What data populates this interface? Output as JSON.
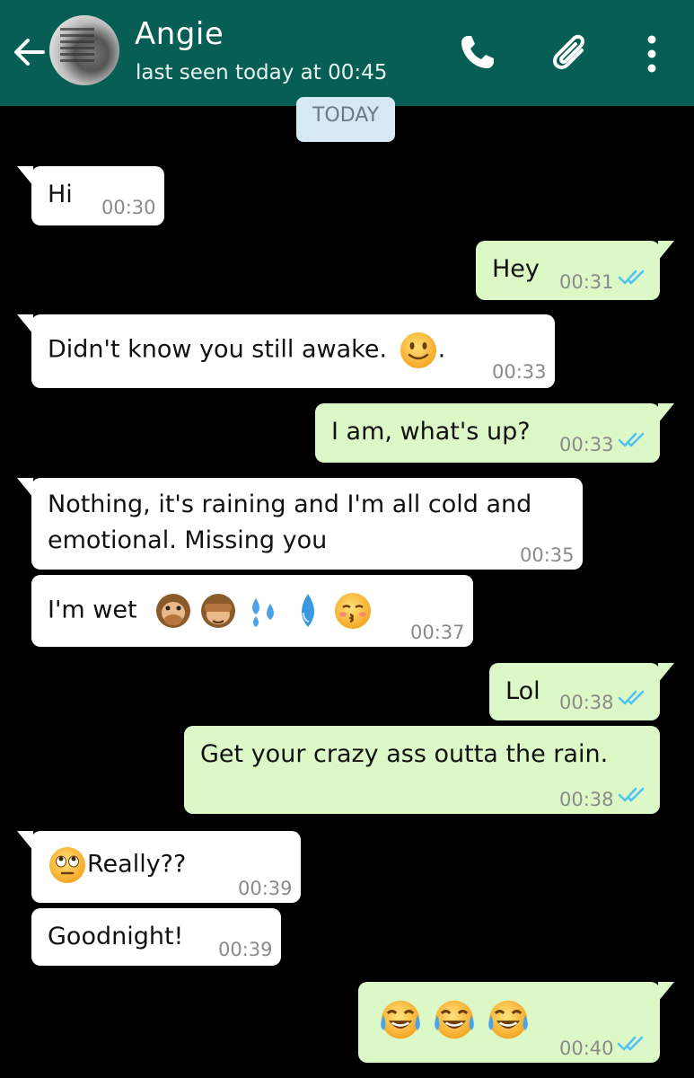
{
  "header": {
    "contact_name": "Angie",
    "last_seen": "last seen today at 00:45",
    "background": "#075e54"
  },
  "date_chip": "TODAY",
  "messages": [
    {
      "dir": "in",
      "text": "Hi",
      "time": "00:30"
    },
    {
      "dir": "out",
      "text": "Hey",
      "time": "00:31",
      "ticks": "read"
    },
    {
      "dir": "in",
      "text": "Didn't know you still awake.",
      "suffix": ".",
      "emoji": [
        "slightly-smiling-face"
      ],
      "time": "00:33"
    },
    {
      "dir": "out",
      "text": "I am, what's up?",
      "time": "00:33",
      "ticks": "read"
    },
    {
      "dir": "in",
      "line1": "Nothing, it's raining and I'm all cold and",
      "line2": "emotional. Missing you",
      "time": "00:35"
    },
    {
      "dir": "in",
      "text": "I'm wet",
      "emoji": [
        "speak-no-evil-monkey",
        "see-no-evil-monkey",
        "sweat-droplets",
        "droplet",
        "kissing-face-closed-eyes"
      ],
      "time": "00:37"
    },
    {
      "dir": "out",
      "text": "Lol",
      "time": "00:38",
      "ticks": "read"
    },
    {
      "dir": "out",
      "text": "Get your crazy ass outta the rain.",
      "time": "00:38",
      "ticks": "read"
    },
    {
      "dir": "in",
      "text": "Really??",
      "emoji": [
        "face-with-rolling-eyes"
      ],
      "time": "00:39"
    },
    {
      "dir": "in",
      "text": "Goodnight!",
      "time": "00:39"
    },
    {
      "dir": "out",
      "emoji": [
        "face-with-tears-of-joy",
        "face-with-tears-of-joy",
        "face-with-tears-of-joy"
      ],
      "time": "00:40",
      "ticks": "read"
    }
  ],
  "colors": {
    "incoming": "#ffffff",
    "outgoing": "#dcf8c6",
    "read_ticks": "#4fc3f7",
    "chat_background": "#000000"
  }
}
